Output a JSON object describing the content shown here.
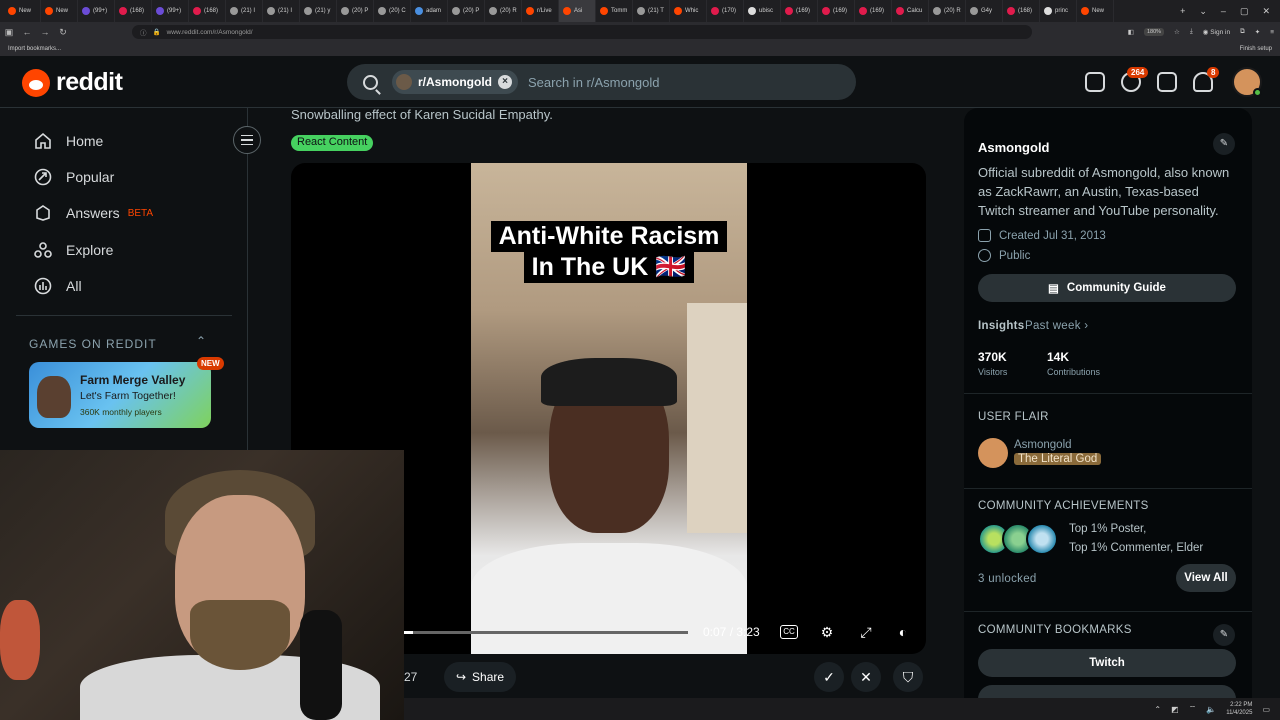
{
  "browser": {
    "tabs": [
      {
        "label": "New",
        "color": "#ff4500"
      },
      {
        "label": "New",
        "color": "#ff4500"
      },
      {
        "label": "(99+)",
        "color": "#6b4cd6"
      },
      {
        "label": "(168)",
        "color": "#e01b4c"
      },
      {
        "label": "(99+)",
        "color": "#6b4cd6"
      },
      {
        "label": "(168)",
        "color": "#e01b4c"
      },
      {
        "label": "(21) I",
        "color": "#999999"
      },
      {
        "label": "(21) I",
        "color": "#999999"
      },
      {
        "label": "(21) y",
        "color": "#999999"
      },
      {
        "label": "(20) P",
        "color": "#999999"
      },
      {
        "label": "(20) C",
        "color": "#999999"
      },
      {
        "label": "adam",
        "color": "#4a8fe0"
      },
      {
        "label": "(20) P",
        "color": "#999999"
      },
      {
        "label": "(20) R",
        "color": "#999999"
      },
      {
        "label": "r/Live",
        "color": "#ff4500"
      },
      {
        "label": "Asi",
        "color": "#ff4500"
      },
      {
        "label": "Tomm",
        "color": "#ff4500"
      },
      {
        "label": "(21) T",
        "color": "#999999"
      },
      {
        "label": "Whic",
        "color": "#ff4500"
      },
      {
        "label": "(170)",
        "color": "#e01b4c"
      },
      {
        "label": "ubisc",
        "color": "#dddddd"
      },
      {
        "label": "(169)",
        "color": "#e01b4c"
      },
      {
        "label": "(169)",
        "color": "#e01b4c"
      },
      {
        "label": "(169)",
        "color": "#e01b4c"
      },
      {
        "label": "Calcu",
        "color": "#e01b4c"
      },
      {
        "label": "(20) R",
        "color": "#999999"
      },
      {
        "label": "G4y",
        "color": "#999999"
      },
      {
        "label": "(168)",
        "color": "#e01b4c"
      },
      {
        "label": "princ",
        "color": "#dddddd"
      },
      {
        "label": "New",
        "color": "#ff4500"
      }
    ],
    "active_tab_index": 15,
    "url": "www.reddit.com/r/Asmongold/",
    "zoom": "180%",
    "sign_in": "Sign in",
    "bookmark_import": "Import bookmarks...",
    "finish_setup": "Finish setup"
  },
  "header": {
    "logo_text": "reddit",
    "search_chip": "r/Asmongold",
    "search_placeholder": "Search in r/Asmongold",
    "chat_badge": "264",
    "notif_badge": "8"
  },
  "leftnav": {
    "items": [
      {
        "label": "Home",
        "icon": "home-icon"
      },
      {
        "label": "Popular",
        "icon": "popular-icon"
      },
      {
        "label": "Answers",
        "icon": "answers-icon"
      },
      {
        "label": "Explore",
        "icon": "explore-icon"
      },
      {
        "label": "All",
        "icon": "all-icon"
      }
    ],
    "answers_badge": "BETA",
    "games_header": "GAMES ON REDDIT",
    "game": {
      "title": "Farm Merge Valley",
      "subtitle": "Let's Farm Together!",
      "plays": "360K monthly players",
      "badge": "NEW"
    }
  },
  "post": {
    "snippet": "Snowballing effect of Karen Sucidal Empathy.",
    "flair": "React Content",
    "video_caption_line1": "Anti-White Racism",
    "video_caption_line2": "In The UK 🇬🇧",
    "time": "0:07 / 3:23",
    "progress": 0.036,
    "vote_count": "27",
    "share_label": "Share"
  },
  "sidebar": {
    "name": "Asmongold",
    "description": "Official subreddit of Asmongold, also known as ZackRawrr, an Austin, Texas-based Twitch streamer and YouTube personality.",
    "created": "Created Jul 31, 2013",
    "visibility": "Public",
    "guide_button": "Community Guide",
    "insights_label": "Insights",
    "insights_period": "Past week ›",
    "visitors_value": "370K",
    "visitors_label": "Visitors",
    "contributions_value": "14K",
    "contributions_label": "Contributions",
    "user_flair_header": "USER FLAIR",
    "flair_user": "Asmongold",
    "flair_text": "The Literal God",
    "achievements_header": "COMMUNITY ACHIEVEMENTS",
    "achievements_line1": "Top 1% Poster,",
    "achievements_line2": "Top 1% Commenter, Elder",
    "unlocked": "3 unlocked",
    "view_all": "View All",
    "bookmarks_header": "COMMUNITY BOOKMARKS",
    "bookmark_twitch": "Twitch"
  },
  "taskbar": {
    "time": "2:22 PM",
    "date": "11/4/2025"
  }
}
